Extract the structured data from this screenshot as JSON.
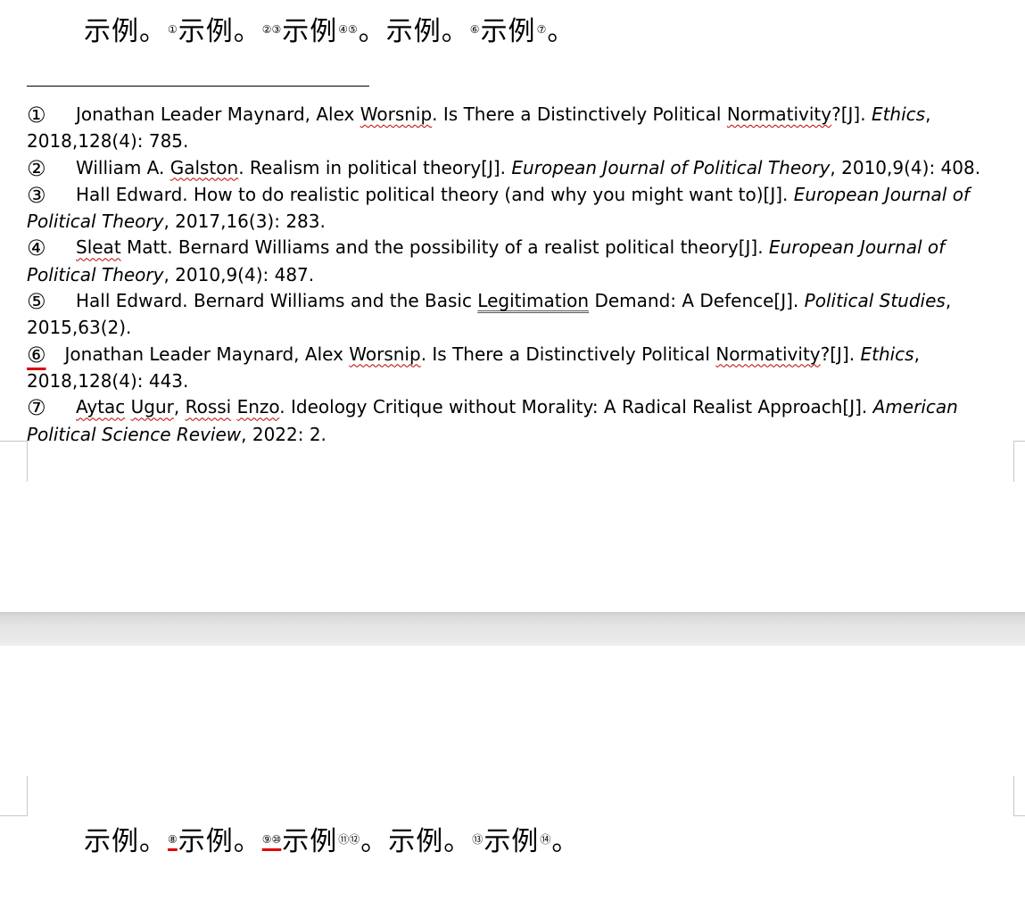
{
  "page1": {
    "body": {
      "s1": "示例。",
      "r1": "①",
      "s2": "示例。",
      "r2": "②③",
      "s3": "示例",
      "r3": "④⑤",
      "s4": "。示例。",
      "r4": "⑥",
      "s5": "示例",
      "r5": "⑦",
      "s6": "。"
    },
    "footnotes": [
      {
        "mark": "①",
        "pre": "Jonathan Leader Maynard, Alex ",
        "w1": "Worsnip",
        "mid": ". Is There a Distinctively Political ",
        "w2": "Normativity",
        "post": "?[J]. ",
        "journal": "Ethics",
        "tail": ", 2018,128(4): 785."
      },
      {
        "mark": "②",
        "pre": "William A. ",
        "w1": "Galston",
        "post": ". Realism in political theory[J]. ",
        "journal": "European Journal of Political Theory",
        "tail": ", 2010,9(4): 408."
      },
      {
        "mark": "③",
        "post": "Hall Edward. How to do realistic political theory (and why you might want to)[J]. ",
        "journal": "European Journal of Political Theory",
        "tail": ", 2017,16(3): 283."
      },
      {
        "mark": "④",
        "w1": "Sleat",
        "post": " Matt. Bernard Williams and the possibility of a realist political theory[J]. ",
        "journal": "European Journal of Political Theory",
        "tail": ", 2010,9(4): 487."
      },
      {
        "mark": "⑤",
        "pre": "Hall Edward. Bernard Williams and the Basic ",
        "w1": "Legitimation",
        "post": " Demand: A Defence[J]. ",
        "journal": "Political Studies",
        "tail": ", 2015,63(2)."
      },
      {
        "mark": "⑥",
        "pre": "Jonathan Leader Maynard, Alex ",
        "w1": "Worsnip",
        "mid": ". Is There a Distinctively Political ",
        "w2": "Normativity",
        "post": "?[J]. ",
        "journal": "Ethics",
        "tail": ", 2018,128(4): 443."
      },
      {
        "mark": "⑦",
        "w1": "Aytac",
        "pre2": " ",
        "w2": "Ugur",
        "mid": ", ",
        "w3": "Rossi",
        "mid2": " ",
        "w4": "Enzo",
        "post": ". Ideology Critique without Morality: A Radical Realist Approach[J]. ",
        "journal": "American Political Science Review",
        "tail": ", 2022: 2."
      }
    ]
  },
  "page2": {
    "body": {
      "s1": "示例。",
      "r1": "⑧",
      "s2": "示例。",
      "r2": "⑨⑩",
      "s3": "示例",
      "r3": "⑪⑫",
      "s4": "。示例。",
      "r4": "⑬",
      "s5": "示例",
      "r5": "⑭",
      "s6": "。"
    }
  },
  "colors": {
    "spell_check": "#c00000",
    "highlight_underline": "#e00000",
    "page_gap": "#e4e4e4"
  }
}
